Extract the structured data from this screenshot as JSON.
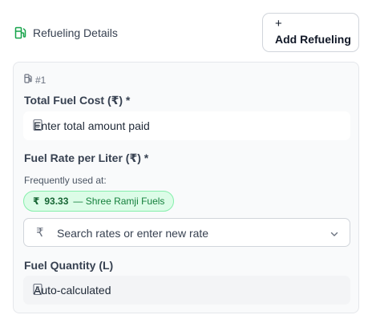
{
  "header": {
    "title": "Refueling Details",
    "add_plus": "+",
    "add_label": "Add Refueling"
  },
  "entry": {
    "tag": "#1",
    "total_cost": {
      "label": "Total Fuel Cost (₹) *",
      "placeholder": "Enter total amount paid"
    },
    "fuel_rate": {
      "label": "Fuel Rate per Liter (₹) *",
      "hint": "Frequently used at:",
      "chip": {
        "currency": "₹",
        "amount": "93.33",
        "station": "— Shree Ramji Fuels"
      },
      "select": {
        "currency": "₹",
        "placeholder": "Search rates or enter new rate"
      }
    },
    "quantity": {
      "label": "Fuel Quantity (L)",
      "placeholder": "Auto-calculated"
    }
  },
  "colors": {
    "accent": "#16a34a",
    "chip_bg": "#dcfce7",
    "chip_border": "#86efac"
  },
  "icons": {
    "title_icon": "fuel-pump-icon",
    "entry_icon": "fuel-pump-icon",
    "select_chevron": "chevron-down-icon"
  }
}
